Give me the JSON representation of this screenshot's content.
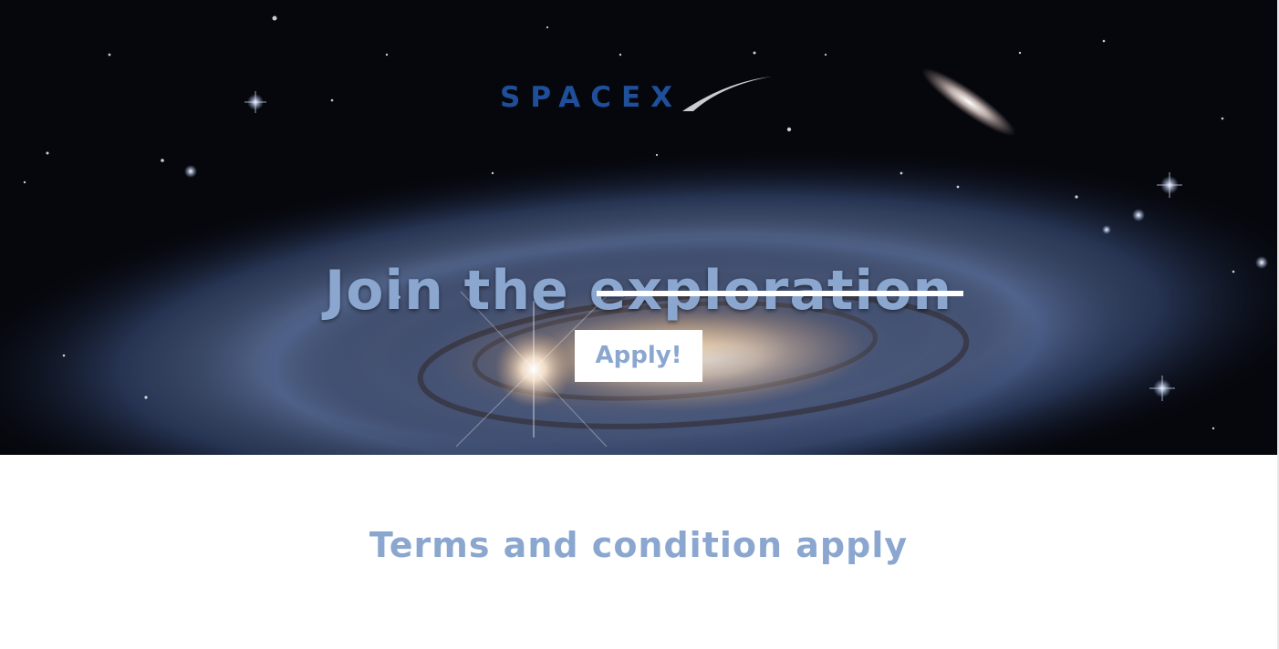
{
  "hero": {
    "logo": {
      "text": "SPACEX",
      "icon": "spacex-logo"
    },
    "headline": "Join the exploration",
    "apply_button_label": "Apply!",
    "background": "galaxy-starfield-image"
  },
  "footer": {
    "terms_text": "Terms and condition apply"
  },
  "colors": {
    "accent": "#8ba7cf",
    "logo_blue": "#1f4f9a",
    "white": "#ffffff"
  }
}
